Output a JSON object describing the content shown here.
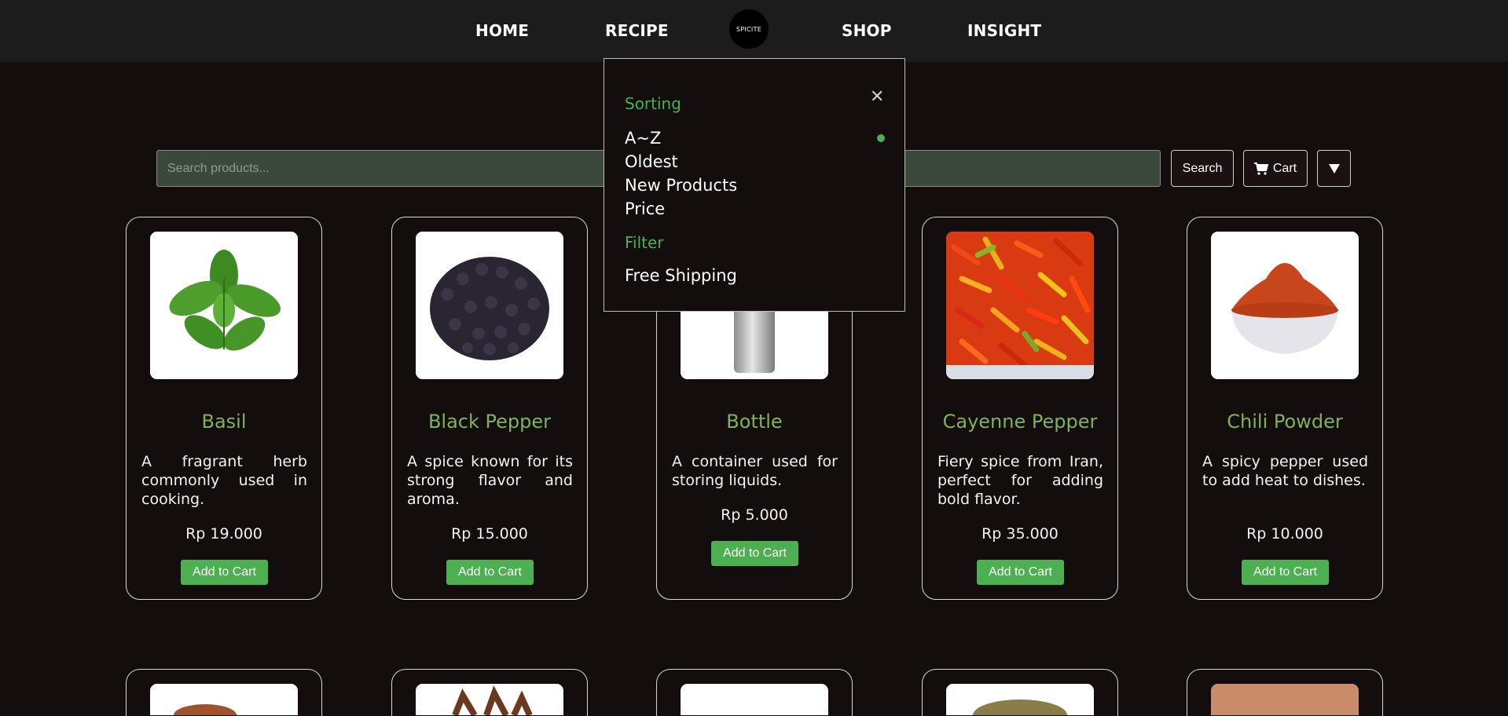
{
  "nav": {
    "home": "HOME",
    "recipe": "RECIPE",
    "logo": "SPICITE",
    "shop": "SHOP",
    "insight": "INSIGHT"
  },
  "search": {
    "placeholder": "Search products...",
    "search_label": "Search",
    "cart_label": "Cart",
    "cart_icon": "cart-icon",
    "filter_icon": "triangle-down-icon"
  },
  "dropdown": {
    "sorting_heading": "Sorting",
    "sort_options": [
      "A~Z",
      "Oldest",
      "New Products",
      "Price"
    ],
    "selected_sort": "A~Z",
    "filter_heading": "Filter",
    "filter_options": [
      "Free Shipping"
    ],
    "close_icon": "close-icon"
  },
  "products": [
    {
      "name": "Basil",
      "desc": "A fragrant herb commonly used in cooking.",
      "price": "Rp 19.000",
      "button": "Add to Cart"
    },
    {
      "name": "Black Pepper",
      "desc": "A spice known for its strong flavor and aroma.",
      "price": "Rp 15.000",
      "button": "Add to Cart"
    },
    {
      "name": "Bottle",
      "desc": "A container used for storing liquids.",
      "price": "Rp 5.000",
      "button": "Add to Cart"
    },
    {
      "name": "Cayenne Pepper",
      "desc": "Fiery spice from Iran, perfect for adding bold flavor.",
      "price": "Rp 35.000",
      "button": "Add to Cart"
    },
    {
      "name": "Chili Powder",
      "desc": "A spicy pepper used to add heat to dishes.",
      "price": "Rp 10.000",
      "button": "Add to Cart"
    }
  ],
  "colors": {
    "background": "#140d0d",
    "navbar": "#1c1c1c",
    "accent_green": "#4caf50",
    "product_name": "#7fb35a",
    "search_bg": "#3a493a"
  }
}
